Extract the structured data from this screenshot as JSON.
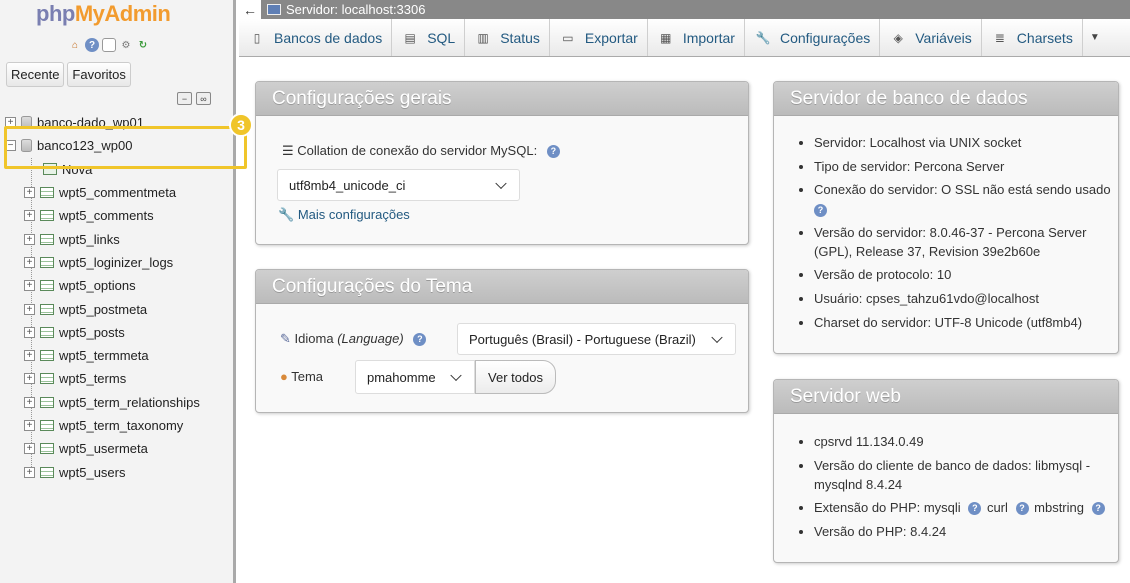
{
  "nav": {
    "logo_php": "php",
    "logo_myadmin": "MyAdmin",
    "icons": [
      "home-icon",
      "help-icon",
      "docs-icon",
      "settings-icon",
      "reload-icon"
    ],
    "tabs": [
      "Recente",
      "Favoritos"
    ],
    "tree": [
      {
        "label": "banco-dado_wp01",
        "type": "db"
      },
      {
        "label": "banco123_wp00",
        "type": "db"
      },
      {
        "label": "Nova",
        "type": "new"
      },
      {
        "label": "wpt5_commentmeta",
        "type": "table"
      },
      {
        "label": "wpt5_comments",
        "type": "table"
      },
      {
        "label": "wpt5_links",
        "type": "table"
      },
      {
        "label": "wpt5_loginizer_logs",
        "type": "table"
      },
      {
        "label": "wpt5_options",
        "type": "table"
      },
      {
        "label": "wpt5_postmeta",
        "type": "table"
      },
      {
        "label": "wpt5_posts",
        "type": "table"
      },
      {
        "label": "wpt5_termmeta",
        "type": "table"
      },
      {
        "label": "wpt5_terms",
        "type": "table"
      },
      {
        "label": "wpt5_term_relationships",
        "type": "table"
      },
      {
        "label": "wpt5_term_taxonomy",
        "type": "table"
      },
      {
        "label": "wpt5_usermeta",
        "type": "table"
      },
      {
        "label": "wpt5_users",
        "type": "table"
      }
    ],
    "highlight_step": "3"
  },
  "serverbar": {
    "back": "←",
    "title": "Servidor: localhost:3306"
  },
  "topmenu": [
    {
      "label": "Bancos de dados",
      "icon": "database-icon"
    },
    {
      "label": "SQL",
      "icon": "sql-icon"
    },
    {
      "label": "Status",
      "icon": "status-icon"
    },
    {
      "label": "Exportar",
      "icon": "export-icon"
    },
    {
      "label": "Importar",
      "icon": "import-icon"
    },
    {
      "label": "Configurações",
      "icon": "wrench-icon"
    },
    {
      "label": "Variáveis",
      "icon": "variables-icon"
    },
    {
      "label": "Charsets",
      "icon": "charsets-icon"
    }
  ],
  "general": {
    "title": "Configurações gerais",
    "collation_label": "Collation de conexão do servidor MySQL:",
    "collation_value": "utf8mb4_unicode_ci",
    "more_link": "Mais configurações"
  },
  "theme": {
    "title": "Configurações do Tema",
    "language_label": "Idioma",
    "language_hint": "(Language)",
    "language_value": "Português (Brasil) - Portuguese (Brazil)",
    "theme_label": "Tema",
    "theme_value": "pmahomme",
    "view_all": "Ver todos"
  },
  "dbserver": {
    "title": "Servidor de banco de dados",
    "items": [
      "Servidor: Localhost via UNIX socket",
      "Tipo de servidor: Percona Server",
      "Conexão do servidor: O SSL não está sendo usado",
      "Versão do servidor: 8.0.46-37 - Percona Server (GPL), Release 37, Revision 39e2b60e",
      "Versão de protocolo: 10",
      "Usuário: cpses_tahzu61vdo@localhost",
      "Charset do servidor: UTF-8 Unicode (utf8mb4)"
    ]
  },
  "webserver": {
    "title": "Servidor web",
    "items": [
      "cpsrvd 11.134.0.49",
      "Versão do cliente de banco de dados: libmysql - mysqlnd 8.4.24",
      "Versão do PHP: 8.4.24"
    ],
    "ext_label": "Extensão do PHP: mysqli",
    "ext_curl": "curl",
    "ext_mbstring": "mbstring"
  }
}
